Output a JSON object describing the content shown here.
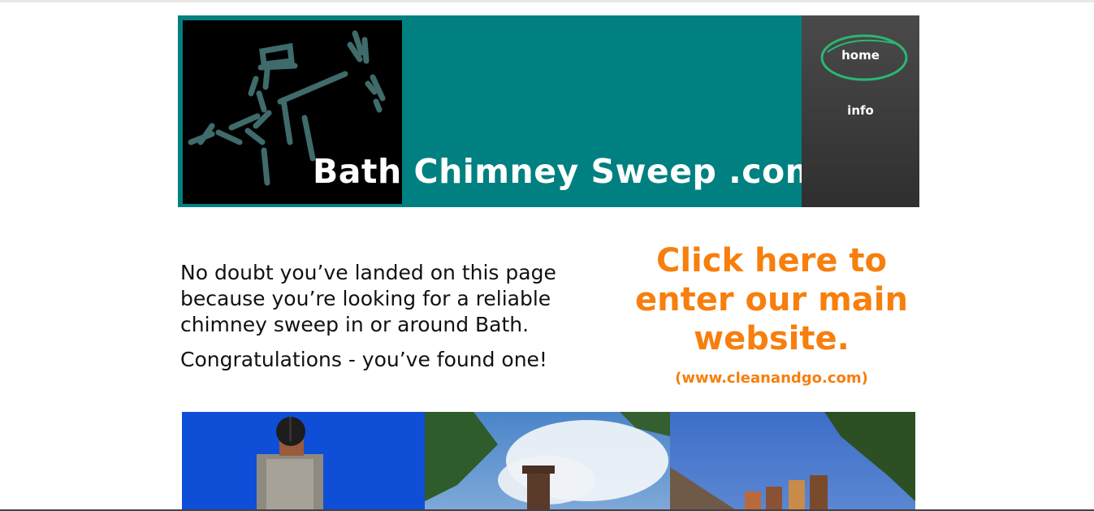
{
  "header": {
    "title": "Bath Chimney Sweep .com"
  },
  "nav": {
    "items": [
      {
        "label": "home"
      },
      {
        "label": "info"
      }
    ]
  },
  "intro": {
    "paragraph1": "No doubt you’ve landed on this page because you’re looking for a reliable chimney sweep in or around Bath.",
    "paragraph2": "Congratulations - you’ve found one!"
  },
  "cta": {
    "main": "Click here to enter our main website.",
    "url": "(www.cleanandgo.com)"
  },
  "colors": {
    "header_teal": "#008080",
    "cta_orange": "#f77f0d",
    "nav_dark": "#3a3a3a",
    "nav_highlight": "#2bb673"
  },
  "photos": [
    {
      "subject": "chimney-stack-blue-sky"
    },
    {
      "subject": "chimney-pot-smoke-trees"
    },
    {
      "subject": "chimney-pots-row-trees"
    }
  ]
}
